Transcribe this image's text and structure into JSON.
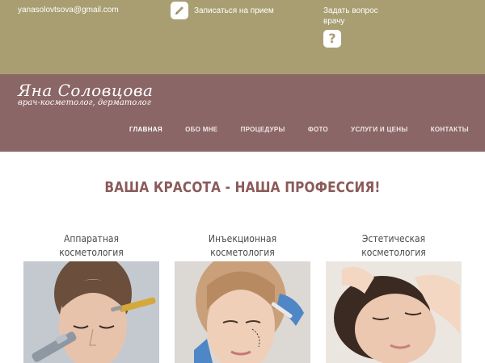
{
  "topbar": {
    "email": "yanasolovtsova@gmail.com",
    "appointment_label": "Записаться на прием",
    "ask_label_line1": "Задать вопрос",
    "ask_label_line2": "врачу",
    "pencil_icon": "pencil-icon",
    "question_icon": "question-icon",
    "question_glyph": "?"
  },
  "header": {
    "logo_name": "Яна Соловцова",
    "logo_subtitle": "врач-косметолог, дерматолог",
    "nav": [
      {
        "label": "ГЛАВНАЯ"
      },
      {
        "label": "ОБО МНЕ"
      },
      {
        "label": "ПРОЦЕДУРЫ"
      },
      {
        "label": "ФОТО"
      },
      {
        "label": "УСЛУГИ И ЦЕНЫ"
      },
      {
        "label": "КОНТАКТЫ"
      }
    ]
  },
  "main": {
    "headline": "ВАША КРАСОТА - НАША ПРОФЕССИЯ!",
    "cards": [
      {
        "title_line1": "Аппаратная",
        "title_line2": "косметология"
      },
      {
        "title_line1": "Инъекционная",
        "title_line2": "косметология"
      },
      {
        "title_line1": "Эстетическая",
        "title_line2": "косметология"
      }
    ]
  },
  "colors": {
    "topbar": "#a89e72",
    "header": "#8b6666",
    "headline": "#8b5a5a"
  }
}
